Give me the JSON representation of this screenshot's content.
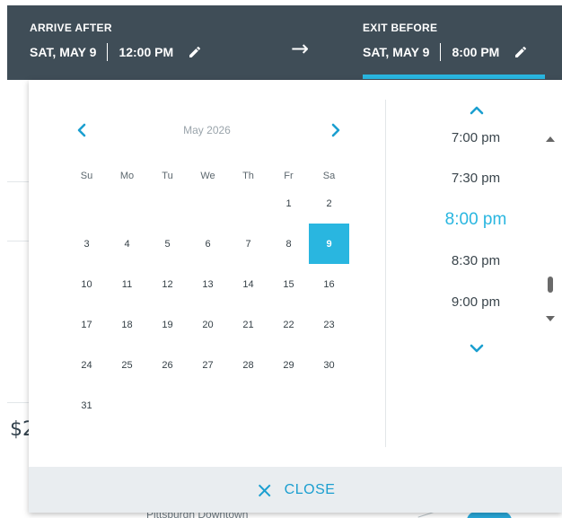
{
  "header": {
    "arrive": {
      "label": "ARRIVE AFTER",
      "date": "SAT, MAY 9",
      "time": "12:00 PM"
    },
    "exit": {
      "label": "EXIT BEFORE",
      "date": "SAT, MAY 9",
      "time": "8:00 PM"
    },
    "arrow": "→"
  },
  "calendar": {
    "month_title": "May 2026",
    "prev": "‹",
    "next": "›",
    "weekdays": [
      "Su",
      "Mo",
      "Tu",
      "We",
      "Th",
      "Fr",
      "Sa"
    ],
    "first_weekday_index": 5,
    "days_in_month": 31,
    "selected_day": 9
  },
  "times": {
    "items": [
      "7:00 pm",
      "7:30 pm",
      "8:00 pm",
      "8:30 pm",
      "9:00 pm"
    ],
    "selected": "8:00 pm"
  },
  "footer": {
    "close_label": "CLOSE",
    "close_icon": "×"
  },
  "background": {
    "price_fragment": "$2",
    "map_label": "Pittsburgh Downtown"
  },
  "colors": {
    "header_bg": "#3f4d57",
    "accent": "#29b6e0",
    "footer_bg": "#e9edf0"
  }
}
